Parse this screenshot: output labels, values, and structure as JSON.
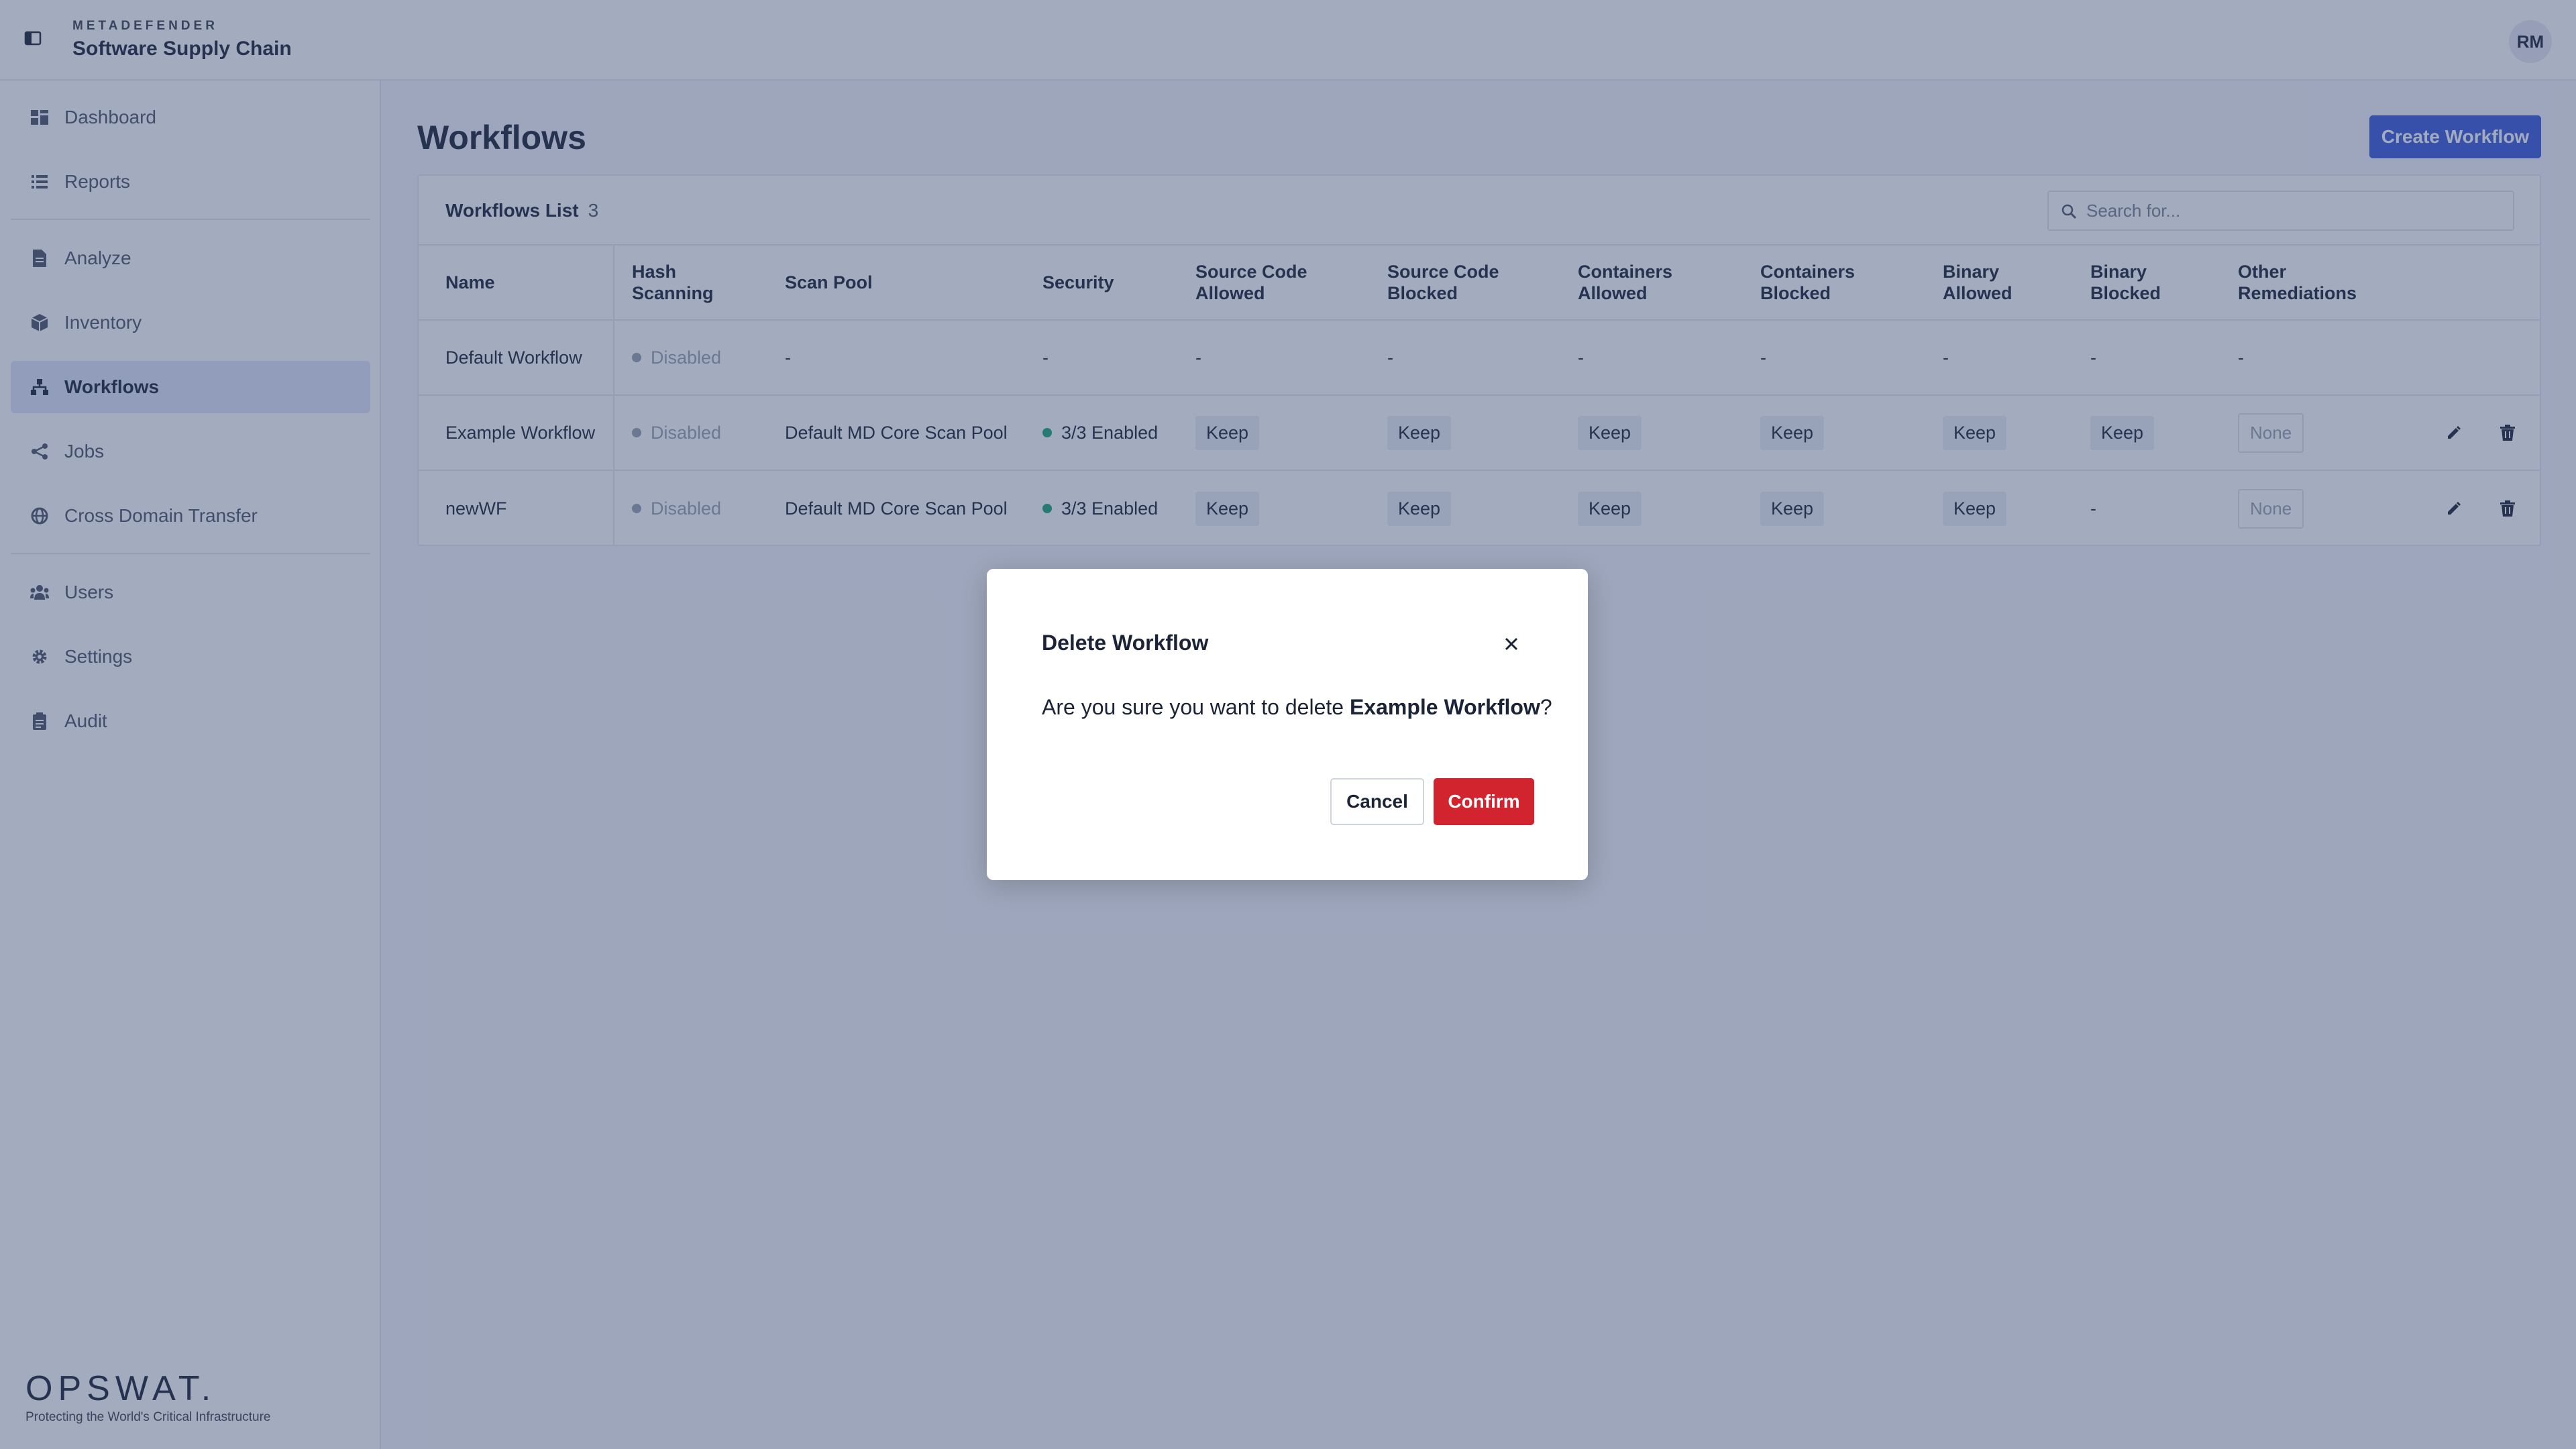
{
  "header": {
    "brand_sub": "METADEFENDER",
    "brand_title": "Software Supply Chain",
    "avatar": "RM",
    "collapse_icon": "sidebar-collapse-icon"
  },
  "sidebar": {
    "items": [
      {
        "label": "Dashboard",
        "icon": "dashboard-icon"
      },
      {
        "label": "Reports",
        "icon": "list-icon"
      },
      {
        "label": "Analyze",
        "icon": "file-icon"
      },
      {
        "label": "Inventory",
        "icon": "cube-icon"
      },
      {
        "label": "Workflows",
        "icon": "workflow-icon",
        "active": true
      },
      {
        "label": "Jobs",
        "icon": "share-icon"
      },
      {
        "label": "Cross Domain Transfer",
        "icon": "globe-icon"
      },
      {
        "label": "Users",
        "icon": "users-icon"
      },
      {
        "label": "Settings",
        "icon": "gear-icon"
      },
      {
        "label": "Audit",
        "icon": "clipboard-icon"
      }
    ],
    "footer": {
      "logo": "OPSWAT.",
      "tagline": "Protecting the World's Critical Infrastructure"
    }
  },
  "main": {
    "title": "Workflows",
    "create_button": "Create Workflow",
    "list_title": "Workflows List",
    "list_count": "3",
    "search_placeholder": "Search for...",
    "columns": {
      "name": "Name",
      "hash_scanning": [
        "Hash",
        "Scanning"
      ],
      "scan_pool": "Scan Pool",
      "security": "Security",
      "source_allowed": [
        "Source Code",
        "Allowed"
      ],
      "source_blocked": [
        "Source Code",
        "Blocked"
      ],
      "containers_allowed": [
        "Containers",
        "Allowed"
      ],
      "containers_blocked": [
        "Containers",
        "Blocked"
      ],
      "binary_allowed": [
        "Binary",
        "Allowed"
      ],
      "binary_blocked": [
        "Binary",
        "Blocked"
      ],
      "other": [
        "Other",
        "Remediations"
      ]
    },
    "rows": [
      {
        "name": "Default Workflow",
        "hash": "Disabled",
        "pool": "-",
        "security": "-",
        "src_allowed": "-",
        "src_blocked": "-",
        "cont_allowed": "-",
        "cont_blocked": "-",
        "bin_allowed": "-",
        "bin_blocked": "-",
        "other": "-"
      },
      {
        "name": "Example Workflow",
        "hash": "Disabled",
        "pool": "Default MD Core Scan Pool",
        "security": "3/3 Enabled",
        "src_allowed": "Keep",
        "src_blocked": "Keep",
        "cont_allowed": "Keep",
        "cont_blocked": "Keep",
        "bin_allowed": "Keep",
        "bin_blocked": "Keep",
        "other": "None"
      },
      {
        "name": "newWF",
        "hash": "Disabled",
        "pool": "Default MD Core Scan Pool",
        "security": "3/3 Enabled",
        "src_allowed": "Keep",
        "src_blocked": "Keep",
        "cont_allowed": "Keep",
        "cont_blocked": "Keep",
        "bin_allowed": "Keep",
        "bin_blocked": "-",
        "other": "None"
      }
    ]
  },
  "modal": {
    "title": "Delete Workflow",
    "body_prefix": "Are you sure you want to delete ",
    "body_target": "Example Workflow",
    "body_suffix": "?",
    "cancel": "Cancel",
    "confirm": "Confirm"
  },
  "colors": {
    "accent": "#3b5bdb",
    "danger": "#d1242f",
    "success": "#1aa779",
    "overlay": "#32446e"
  }
}
